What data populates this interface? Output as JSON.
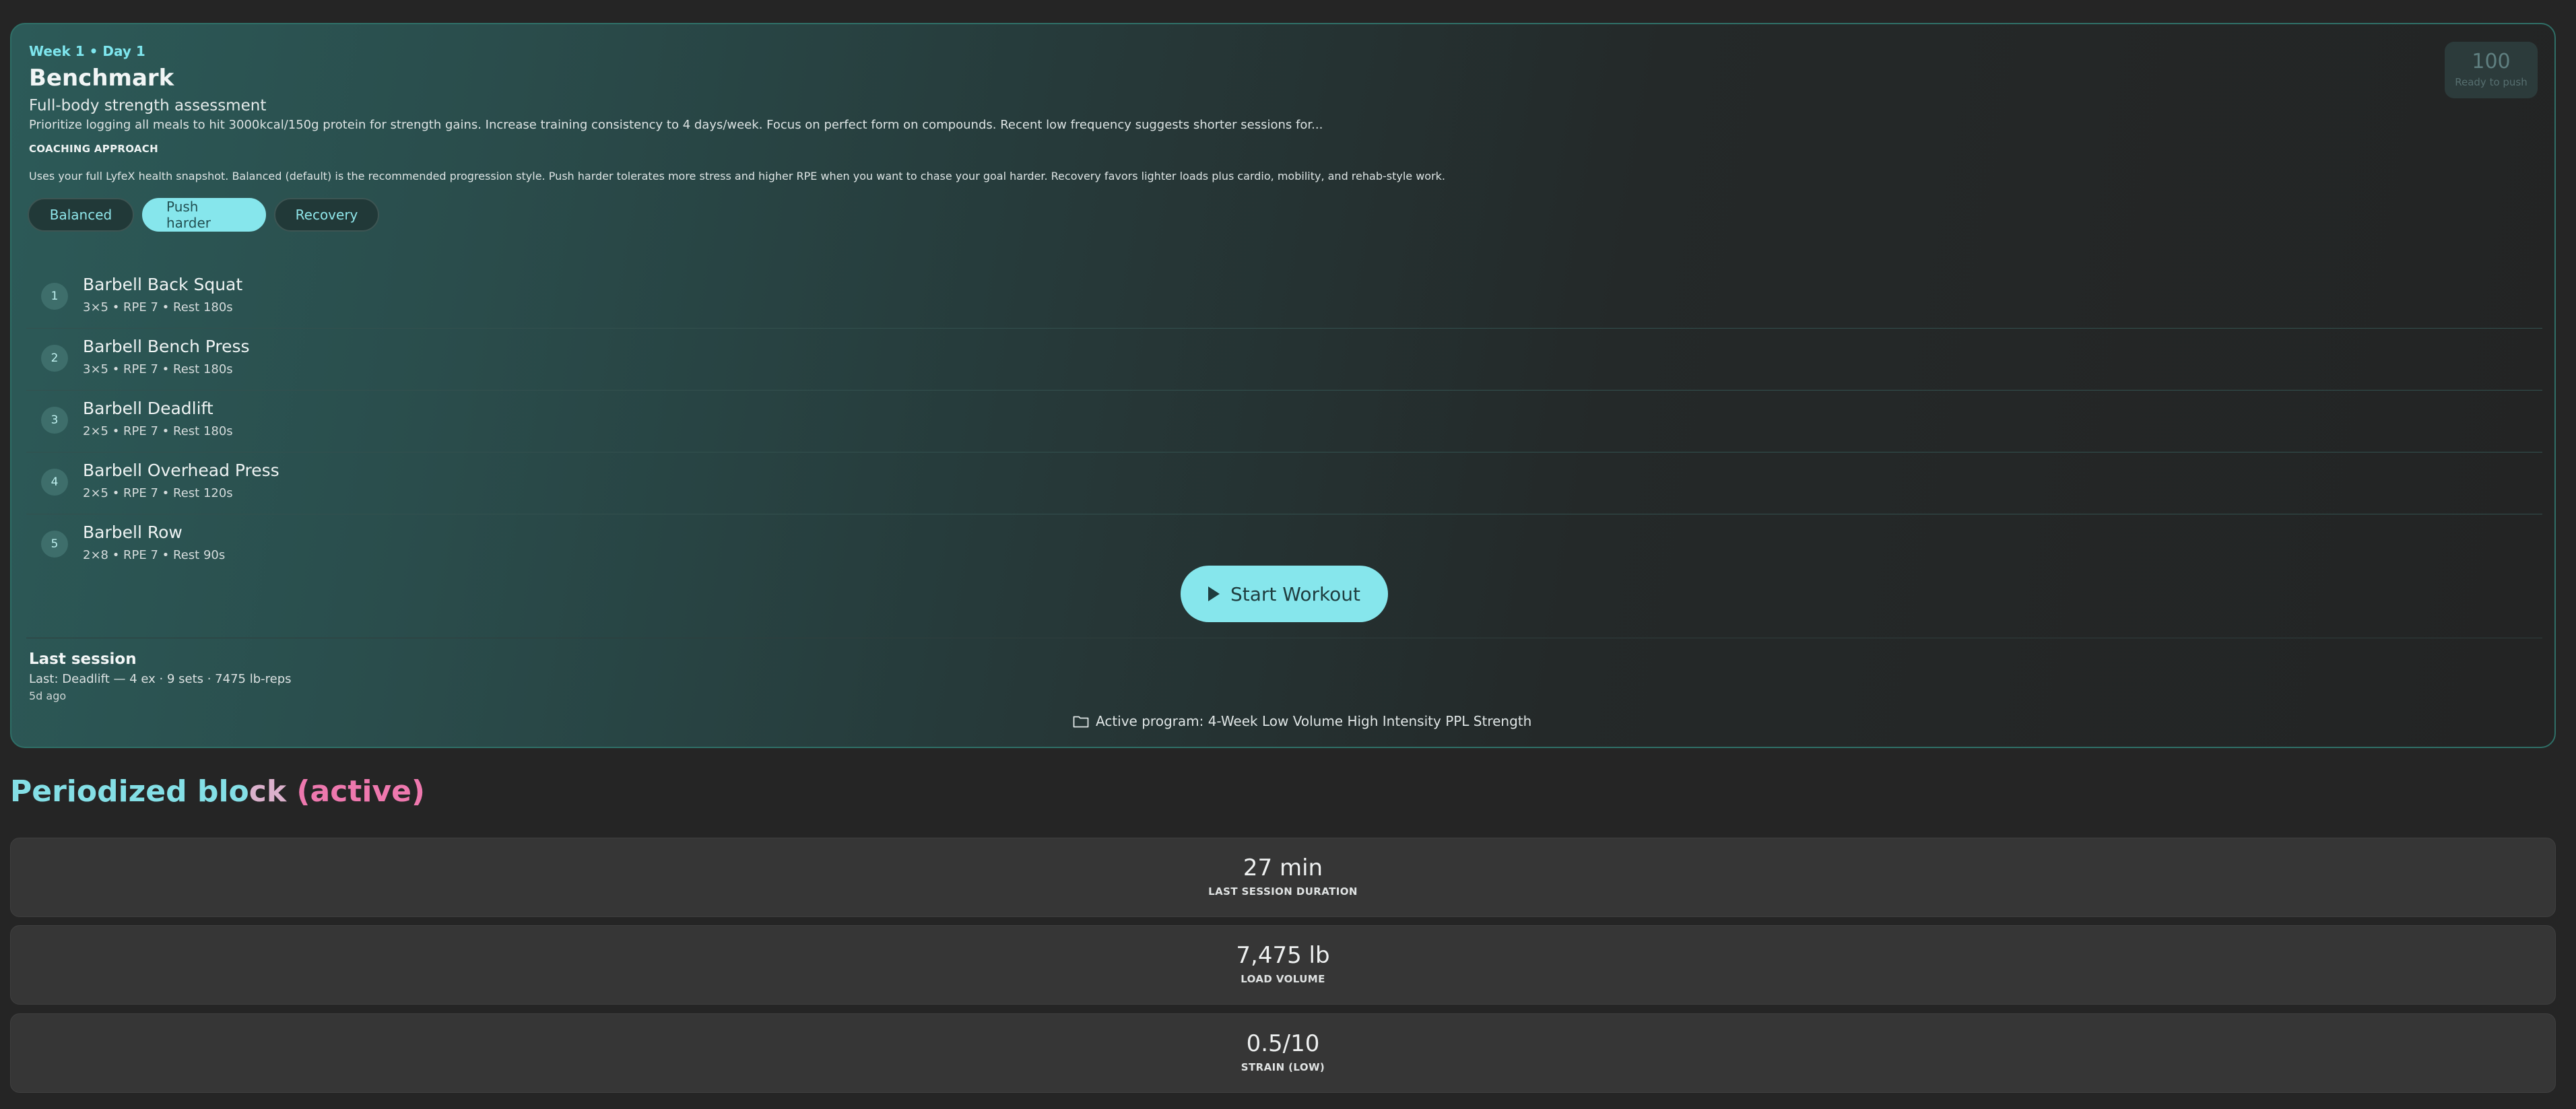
{
  "workout": {
    "week_day": "Week 1 • Day 1",
    "title": "Benchmark",
    "subtitle": "Full-body strength assessment",
    "note": "Prioritize logging all meals to hit 3000kcal/150g protein for strength gains. Increase training consistency to 4 days/week. Focus on perfect form on compounds. Recent low frequency suggests shorter sessions for...",
    "coaching_heading": "COACHING APPROACH",
    "coaching_desc": "Uses your full LyfeX health snapshot. Balanced (default) is the recommended progression style. Push harder tolerates more stress and higher RPE when you want to chase your goal harder. Recovery favors lighter loads plus cardio, mobility, and rehab-style work.",
    "approaches": [
      {
        "label": "Balanced",
        "active": false
      },
      {
        "label": "Push harder",
        "active": true
      },
      {
        "label": "Recovery",
        "active": false
      }
    ],
    "exercises": [
      {
        "num": "1",
        "name": "Barbell Back Squat",
        "meta": "3×5 • RPE 7 • Rest 180s"
      },
      {
        "num": "2",
        "name": "Barbell Bench Press",
        "meta": "3×5 • RPE 7 • Rest 180s"
      },
      {
        "num": "3",
        "name": "Barbell Deadlift",
        "meta": "2×5 • RPE 7 • Rest 180s"
      },
      {
        "num": "4",
        "name": "Barbell Overhead Press",
        "meta": "2×5 • RPE 7 • Rest 120s"
      },
      {
        "num": "5",
        "name": "Barbell Row",
        "meta": "2×8 • RPE 7 • Rest 90s"
      }
    ],
    "start_label": "Start Workout",
    "last_session_heading": "Last session",
    "last_session_detail": "Last: Deadlift — 4 ex · 9 sets · 7475 lb-reps",
    "last_session_ago": "5d ago",
    "active_program": "Active program: 4-Week Low Volume High Intensity PPL Strength",
    "readiness": {
      "score": "100",
      "label": "Ready to push"
    }
  },
  "block": {
    "title_part1": "Periodized blo",
    "title_part2": "ck",
    "title_part3": " (active)",
    "stats": [
      {
        "value": "27 min",
        "label": "LAST SESSION DURATION"
      },
      {
        "value": "7,475 lb",
        "label": "LOAD VOLUME"
      },
      {
        "value": "0.5/10",
        "label": "STRAIN (LOW)"
      }
    ]
  },
  "colors": {
    "accent": "#86e6ec",
    "accent_dark_text": "#1f3d3f",
    "pink": "#ee78ae"
  },
  "icons": {
    "start": "play-icon",
    "program": "folder-icon"
  }
}
